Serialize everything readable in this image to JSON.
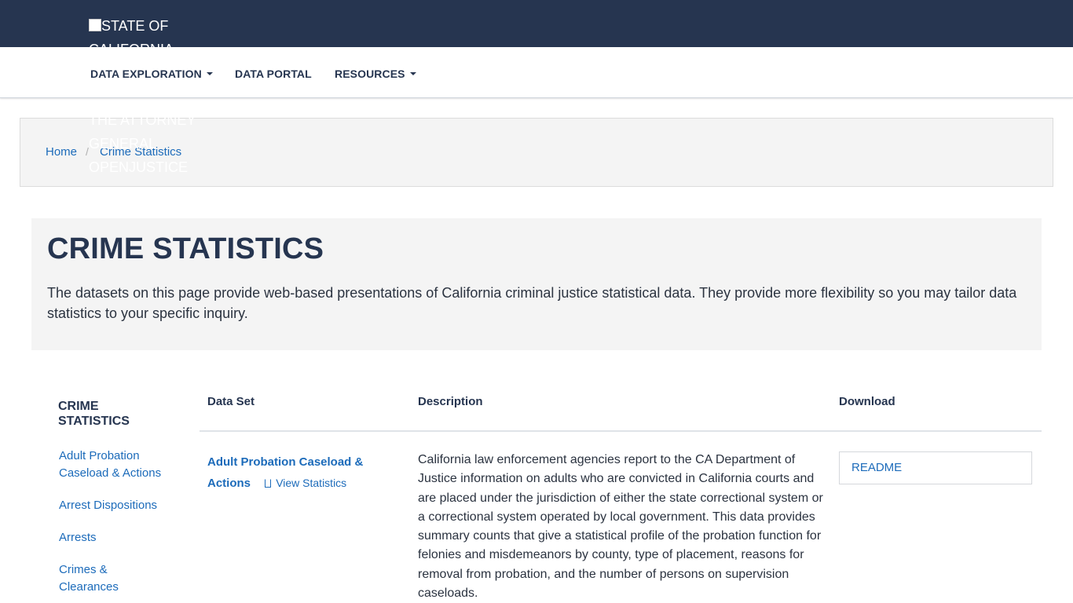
{
  "header": {
    "logo_alt_lines": [
      "STATE OF",
      "CALIFORNIA"
    ],
    "logo_alt_overlay_lines": [
      "THE ATTORNEY",
      "GENERAL",
      "OPENJUSTICE"
    ]
  },
  "nav": {
    "items": [
      {
        "label": "DATA EXPLORATION",
        "has_dropdown": true
      },
      {
        "label": "DATA PORTAL",
        "has_dropdown": false
      },
      {
        "label": "RESOURCES",
        "has_dropdown": true
      }
    ]
  },
  "breadcrumb": {
    "items": [
      "Home",
      "Crime Statistics"
    ],
    "separator": "/"
  },
  "hero": {
    "title": "CRIME STATISTICS",
    "description": "The datasets on this page provide web-based presentations of California criminal justice statistical data. They provide more flexibility so you may tailor data statistics to your specific inquiry."
  },
  "sidebar": {
    "title": "CRIME STATISTICS",
    "links": [
      "Adult Probation Caseload & Actions",
      "Arrest Dispositions",
      "Arrests",
      "Crimes & Clearances"
    ]
  },
  "table": {
    "headers": [
      "Data Set",
      "Description",
      "Download"
    ],
    "rows": [
      {
        "dataset": "Adult Probation Caseload & Actions",
        "view_label": "View Statistics",
        "description": "California law enforcement agencies report to the CA Department of Justice information on adults who are convicted in California courts and are placed under the jurisdiction of either the state correctional system or a correctional system operated by local government. This data provides summary counts that give a statistical profile of the probation function for felonies and misdemeanors by county, type of placement, reasons for removal from probation, and the number of persons on supervision caseloads.",
        "download_label": "README"
      }
    ]
  },
  "colors": {
    "topbar": "#263550",
    "link": "#1c6bba",
    "heading": "#263550",
    "panel": "#f4f4f4"
  }
}
